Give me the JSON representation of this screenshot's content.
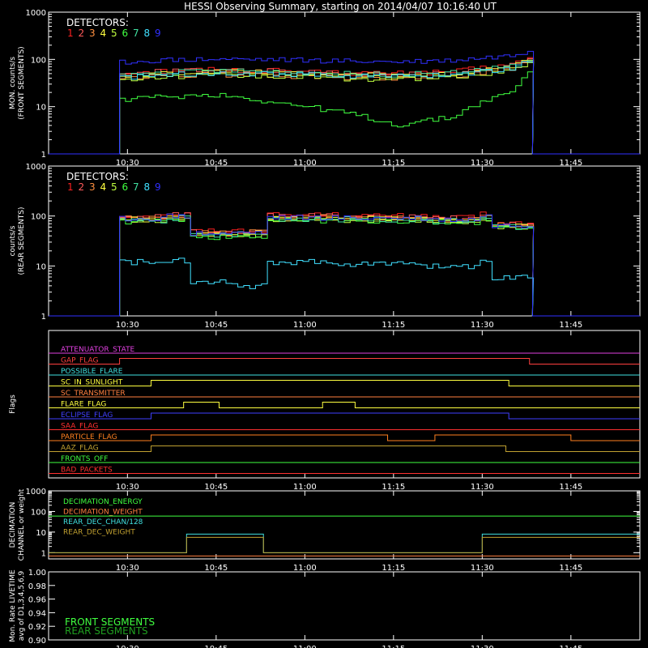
{
  "title": "HESSI Observing Summary, starting on 2014/04/07 10:16:40 UT",
  "colors": {
    "background": "#000000",
    "axes": "#ffffff",
    "det1": "#ff2020",
    "det2": "#ff5a5a",
    "det3": "#ff9040",
    "det4": "#ffff40",
    "det5": "#c0ff40",
    "det6": "#40ff40",
    "det7": "#40e0a0",
    "det8": "#40e0ff",
    "det9": "#3030ff"
  },
  "x_ticks": [
    "10:30",
    "10:45",
    "11:00",
    "11:15",
    "11:30",
    "11:45"
  ],
  "chart_data": [
    {
      "type": "line",
      "panel": "front",
      "ylabel": [
        "MON. counts/s",
        "(FRONT SEGMENTS)"
      ],
      "yscale": "log",
      "ylim": [
        1,
        1000
      ],
      "yticks": [
        "1",
        "10",
        "100",
        "1000"
      ],
      "xlim": [
        "10:16:40",
        "11:56:40"
      ],
      "legend_title": "DETECTORS:",
      "legend_entries": [
        "1",
        "2",
        "3",
        "4",
        "5",
        "6",
        "7",
        "8",
        "9"
      ],
      "legend_placement": "top-left",
      "x": [
        "10:28",
        "10:35",
        "10:45",
        "10:55",
        "11:05",
        "11:15",
        "11:25",
        "11:35",
        "11:38"
      ],
      "series": [
        {
          "values": [
            50,
            58,
            62,
            58,
            52,
            50,
            55,
            78,
            110
          ]
        },
        {
          "values": [
            48,
            55,
            60,
            56,
            50,
            48,
            52,
            75,
            105
          ]
        },
        {
          "values": [
            38,
            45,
            48,
            46,
            42,
            40,
            45,
            65,
            95
          ]
        },
        {
          "values": [
            42,
            50,
            55,
            52,
            48,
            45,
            50,
            70,
            100
          ]
        },
        {
          "values": [
            35,
            42,
            46,
            44,
            40,
            38,
            42,
            60,
            90
          ]
        },
        {
          "values": [
            14,
            16,
            18,
            12,
            8,
            4,
            6,
            20,
            60
          ]
        },
        {
          "values": [
            45,
            52,
            58,
            55,
            50,
            48,
            52,
            72,
            100
          ]
        },
        {
          "values": [
            40,
            48,
            52,
            50,
            46,
            44,
            48,
            66,
            95
          ]
        },
        {
          "values": [
            85,
            95,
            100,
            98,
            92,
            88,
            95,
            120,
            160
          ]
        }
      ]
    },
    {
      "type": "line",
      "panel": "rear",
      "ylabel": [
        "counts/s",
        "(REAR SEGMENTS)"
      ],
      "yscale": "log",
      "ylim": [
        1,
        1000
      ],
      "yticks": [
        "1",
        "10",
        "100",
        "1000"
      ],
      "xlim": [
        "10:16:40",
        "11:56:40"
      ],
      "legend_title": "DETECTORS:",
      "legend_entries": [
        "1",
        "2",
        "3",
        "4",
        "5",
        "6",
        "7",
        "8",
        "9"
      ],
      "legend_placement": "top-left",
      "x": [
        "10:29",
        "10:36",
        "10:40",
        "10:48",
        "10:53",
        "11:05",
        "11:20",
        "11:29",
        "11:31",
        "11:38"
      ],
      "series": [
        {
          "values": [
            100,
            110,
            50,
            52,
            105,
            100,
            92,
            110,
            70,
            80
          ]
        },
        {
          "values": [
            95,
            105,
            48,
            50,
            100,
            96,
            90,
            105,
            68,
            78
          ]
        },
        {
          "values": [
            90,
            100,
            45,
            48,
            95,
            92,
            86,
            100,
            65,
            75
          ]
        },
        {
          "values": [
            85,
            95,
            42,
            45,
            90,
            88,
            82,
            95,
            62,
            72
          ]
        },
        {
          "values": [
            80,
            90,
            40,
            42,
            85,
            84,
            78,
            90,
            60,
            70
          ]
        },
        {
          "values": [
            78,
            88,
            38,
            40,
            82,
            80,
            75,
            88,
            58,
            68
          ]
        },
        {
          "values": [
            82,
            92,
            41,
            44,
            88,
            86,
            80,
            92,
            61,
            71
          ]
        },
        {
          "values": [
            12,
            13,
            5,
            4,
            12,
            11,
            10,
            12,
            6,
            8
          ]
        },
        {
          "values": [
            88,
            98,
            44,
            46,
            92,
            90,
            84,
            98,
            64,
            74
          ]
        }
      ]
    },
    {
      "type": "line",
      "panel": "flags",
      "ylabel": [
        "Flags"
      ],
      "xlim": [
        "10:16:40",
        "11:56:40"
      ],
      "flags": [
        {
          "name": "ATTENUATOR_STATE",
          "color": "#e040e0",
          "transitions": []
        },
        {
          "name": "GAP_FLAG",
          "color": "#ff4040",
          "transitions": [
            "10:28:40",
            "11:38:00"
          ]
        },
        {
          "name": "POSSIBLE_FLARE",
          "color": "#40e0e0",
          "transitions": []
        },
        {
          "name": "SC_IN_SUNLIGHT",
          "color": "#ffff40",
          "transitions": [
            "10:34:00",
            "11:34:30"
          ]
        },
        {
          "name": "SC_TRANSMITTER",
          "color": "#ff8040",
          "transitions": []
        },
        {
          "name": "FLARE_FLAG",
          "color": "#ffff40",
          "transitions": [
            "10:39:30",
            "10:45:30",
            "11:03:00",
            "11:08:30"
          ]
        },
        {
          "name": "ECLIPSE_FLAG",
          "color": "#4040ff",
          "transitions": [
            "10:34:00",
            "11:34:30"
          ]
        },
        {
          "name": "SAA_FLAG",
          "color": "#ff3030",
          "transitions": []
        },
        {
          "name": "PARTICLE_FLAG",
          "color": "#ff8020",
          "transitions": [
            "10:34:00",
            "11:14:00",
            "11:22:00",
            "11:45:00"
          ]
        },
        {
          "name": "AAZ_FLAG",
          "color": "#c0a030",
          "transitions": [
            "10:34:00",
            "11:34:00"
          ]
        },
        {
          "name": "FRONTS_OFF",
          "color": "#40ff40",
          "transitions": []
        },
        {
          "name": "BAD_PACKETS",
          "color": "#ff3030",
          "transitions": []
        }
      ]
    },
    {
      "type": "line",
      "panel": "decimation",
      "ylabel": [
        "DECIMATION",
        "CHANNEL or weight"
      ],
      "yscale": "log",
      "ylim": [
        0.5,
        1000
      ],
      "yticks": [
        "1",
        "10",
        "100",
        "1000"
      ],
      "xlim": [
        "10:16:40",
        "11:56:40"
      ],
      "series": [
        {
          "name": "DECIMATION_ENERGY",
          "color": "#40ff40",
          "values_desc": "constant 1"
        },
        {
          "name": "DECIMATION_WEIGHT",
          "color": "#ff8040",
          "values_desc": "constant 1"
        },
        {
          "name": "REAR_DEC_CHAN/128",
          "color": "#40e0e0",
          "values_desc": "8 from 10:40 to 10:53 and from 11:30 to 11:55, else 1"
        },
        {
          "name": "REAR_DEC_WEIGHT",
          "color": "#c0a030",
          "values_desc": "same as REAR_DEC_CHAN/128"
        }
      ]
    },
    {
      "type": "line",
      "panel": "livetime",
      "ylabel": [
        "Mon. Rate LIVETIME",
        "avg of D1,3,4,5,6,9"
      ],
      "ylim": [
        0.9,
        1.0
      ],
      "yticks": [
        "0.90",
        "0.92",
        "0.94",
        "0.96",
        "0.98",
        "1.00"
      ],
      "series": [
        {
          "name": "FRONT SEGMENTS",
          "color": "#40ff40"
        },
        {
          "name": "REAR SEGMENTS",
          "color": "#20a020"
        }
      ]
    }
  ]
}
